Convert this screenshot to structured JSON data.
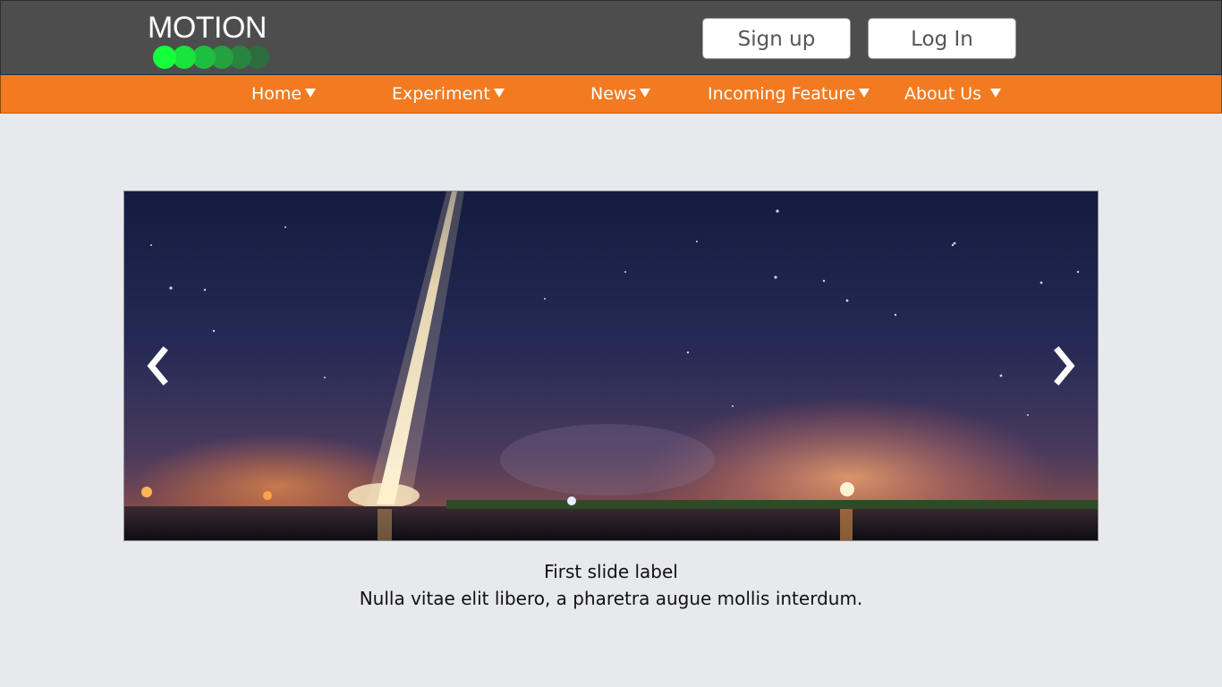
{
  "brand": {
    "name": "MOTION",
    "dot_colors": [
      "#15ff3a",
      "#19e33c",
      "#1dbf3e",
      "#23a23f",
      "#27853f",
      "#2c6d3d"
    ]
  },
  "header": {
    "signup_label": "Sign up",
    "login_label": "Log In"
  },
  "nav": {
    "items": [
      {
        "label": "Home"
      },
      {
        "label": "Experiment"
      },
      {
        "label": "News"
      },
      {
        "label": "Incoming Feature"
      },
      {
        "label": "About Us"
      }
    ]
  },
  "carousel": {
    "slide_icon": "rocket-launch-photo",
    "prev_icon": "chevron-left-icon",
    "next_icon": "chevron-right-icon",
    "caption_title": "First slide label",
    "caption_text": "Nulla vitae elit libero, a pharetra augue mollis interdum."
  },
  "colors": {
    "header_bg": "#4d4d4d",
    "nav_bg": "#f27b21",
    "page_bg": "#e8e9ed"
  }
}
